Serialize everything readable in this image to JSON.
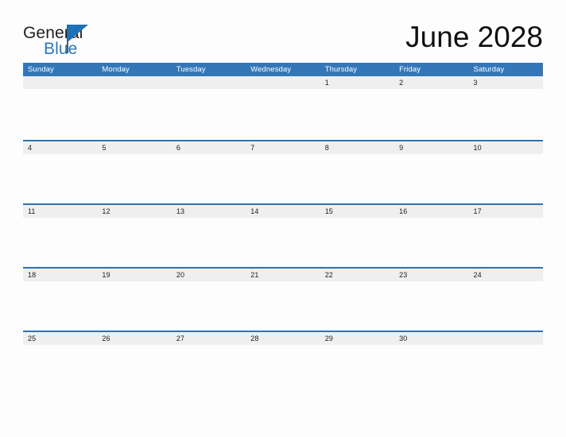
{
  "brand": {
    "line_one": "General",
    "line_two": "Blue",
    "flag_icon": "blue-triangle-flag-icon",
    "text_color": "#231f20",
    "blue_color": "#2878be"
  },
  "header": {
    "title": "June 2028",
    "month": "June",
    "year": "2028"
  },
  "colors": {
    "header_blue": "#3477b8",
    "rule_blue": "#2e72b2",
    "band_gray": "#efefef",
    "page_background": "#fdfdfd",
    "date_text": "#1b1b1b",
    "weekday_text": "#ffffff"
  },
  "calendar": {
    "weekdays": [
      "Sunday",
      "Monday",
      "Tuesday",
      "Wednesday",
      "Thursday",
      "Friday",
      "Saturday"
    ],
    "weeks": [
      {
        "days": [
          "",
          "",
          "",
          "",
          "1",
          "2",
          "3"
        ]
      },
      {
        "days": [
          "4",
          "5",
          "6",
          "7",
          "8",
          "9",
          "10"
        ]
      },
      {
        "days": [
          "11",
          "12",
          "13",
          "14",
          "15",
          "16",
          "17"
        ]
      },
      {
        "days": [
          "18",
          "19",
          "20",
          "21",
          "22",
          "23",
          "24"
        ]
      },
      {
        "days": [
          "25",
          "26",
          "27",
          "28",
          "29",
          "30",
          ""
        ]
      }
    ]
  }
}
